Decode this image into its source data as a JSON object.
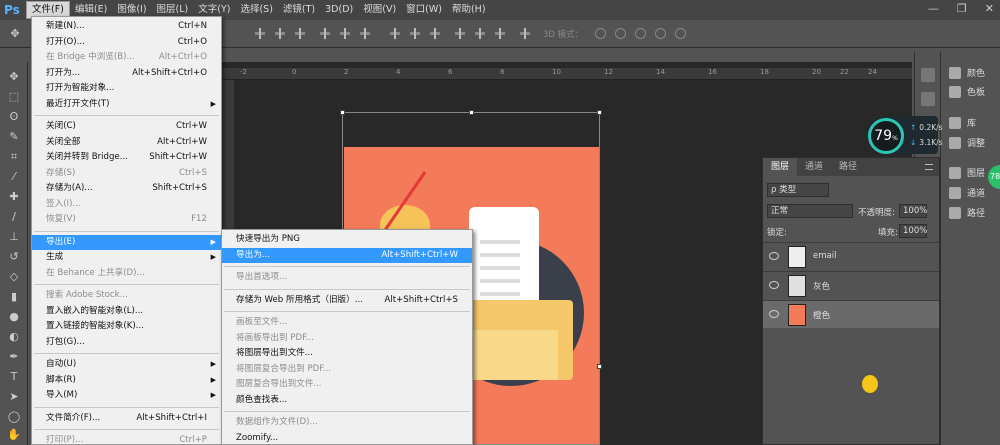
{
  "app": {
    "logo": "Ps"
  },
  "menubar": [
    {
      "label": "文件(F)",
      "active": true
    },
    {
      "label": "编辑(E)"
    },
    {
      "label": "图像(I)"
    },
    {
      "label": "图层(L)"
    },
    {
      "label": "文字(Y)"
    },
    {
      "label": "选择(S)"
    },
    {
      "label": "滤镜(T)"
    },
    {
      "label": "3D(D)"
    },
    {
      "label": "视图(V)"
    },
    {
      "label": "窗口(W)"
    },
    {
      "label": "帮助(H)"
    }
  ],
  "window_controls": {
    "minimize": "—",
    "maximize": "❐",
    "close": "✕"
  },
  "options_bar": {
    "mode3d_label": "3D 模式："
  },
  "ruler": {
    "ticks": [
      "-2",
      "0",
      "2",
      "4",
      "6",
      "8",
      "10",
      "12",
      "14",
      "16",
      "18",
      "20",
      "22",
      "24"
    ]
  },
  "file_menu": [
    {
      "label": "新建(N)...",
      "shortcut": "Ctrl+N"
    },
    {
      "label": "打开(O)...",
      "shortcut": "Ctrl+O"
    },
    {
      "label": "在 Bridge 中浏览(B)...",
      "shortcut": "Alt+Ctrl+O",
      "disabled": true
    },
    {
      "label": "打开为...",
      "shortcut": "Alt+Shift+Ctrl+O"
    },
    {
      "label": "打开为智能对象..."
    },
    {
      "label": "最近打开文件(T)",
      "submenu": true
    },
    {
      "sep": true
    },
    {
      "label": "关闭(C)",
      "shortcut": "Ctrl+W"
    },
    {
      "label": "关闭全部",
      "shortcut": "Alt+Ctrl+W"
    },
    {
      "label": "关闭并转到 Bridge...",
      "shortcut": "Shift+Ctrl+W"
    },
    {
      "label": "存储(S)",
      "shortcut": "Ctrl+S",
      "disabled": true
    },
    {
      "label": "存储为(A)...",
      "shortcut": "Shift+Ctrl+S"
    },
    {
      "label": "签入(I)...",
      "disabled": true
    },
    {
      "label": "恢复(V)",
      "shortcut": "F12",
      "disabled": true
    },
    {
      "sep": true
    },
    {
      "label": "导出(E)",
      "submenu": true,
      "highlighted": true
    },
    {
      "label": "生成",
      "submenu": true
    },
    {
      "label": "在 Behance 上共享(D)...",
      "disabled": true
    },
    {
      "sep": true
    },
    {
      "label": "搜索 Adobe Stock...",
      "disabled": true
    },
    {
      "label": "置入嵌入的智能对象(L)..."
    },
    {
      "label": "置入链接的智能对象(K)..."
    },
    {
      "label": "打包(G)...",
      "disabled": false
    },
    {
      "sep": true
    },
    {
      "label": "自动(U)",
      "submenu": true
    },
    {
      "label": "脚本(R)",
      "submenu": true
    },
    {
      "label": "导入(M)",
      "submenu": true
    },
    {
      "sep": true
    },
    {
      "label": "文件简介(F)...",
      "shortcut": "Alt+Shift+Ctrl+I"
    },
    {
      "sep": true
    },
    {
      "label": "打印(P)...",
      "shortcut": "Ctrl+P",
      "disabled": true
    }
  ],
  "export_menu": [
    {
      "label": "快速导出为 PNG"
    },
    {
      "label": "导出为...",
      "shortcut": "Alt+Shift+Ctrl+W",
      "highlighted": true
    },
    {
      "sep": true
    },
    {
      "label": "导出首选项...",
      "disabled": true
    },
    {
      "sep": true
    },
    {
      "label": "存储为 Web 所用格式（旧版）...",
      "shortcut": "Alt+Shift+Ctrl+S"
    },
    {
      "sep": true
    },
    {
      "label": "画板至文件...",
      "disabled": true
    },
    {
      "label": "将画板导出到 PDF...",
      "disabled": true
    },
    {
      "label": "将图层导出到文件..."
    },
    {
      "label": "将图层复合导出到 PDF...",
      "disabled": true
    },
    {
      "label": "图层复合导出到文件...",
      "disabled": true
    },
    {
      "label": "颜色查找表..."
    },
    {
      "sep": true
    },
    {
      "label": "数据组作为文件(D)...",
      "disabled": true
    },
    {
      "label": "Zoomify..."
    }
  ],
  "right_panel": {
    "items": [
      {
        "label": "颜色"
      },
      {
        "label": "色板"
      },
      {
        "label": "库"
      },
      {
        "label": "调整"
      },
      {
        "label": "图层"
      },
      {
        "label": "通道"
      },
      {
        "label": "路径"
      }
    ]
  },
  "speed_widget": {
    "percent": "79",
    "percent_suffix": "%",
    "up": "0.2",
    "down": "3.1",
    "unit": "K/s"
  },
  "layers_panel": {
    "tabs": [
      "图层",
      "通道",
      "路径"
    ],
    "filter_label": "ρ 类型",
    "blend_mode": "正常",
    "opacity_label": "不透明度:",
    "opacity_value": "100%",
    "lock_label": "锁定:",
    "fill_label": "填充:",
    "fill_value": "100%",
    "layers": [
      {
        "name": "email",
        "selected": false
      },
      {
        "name": "灰色",
        "selected": false
      },
      {
        "name": "橙色",
        "selected": true
      }
    ]
  }
}
